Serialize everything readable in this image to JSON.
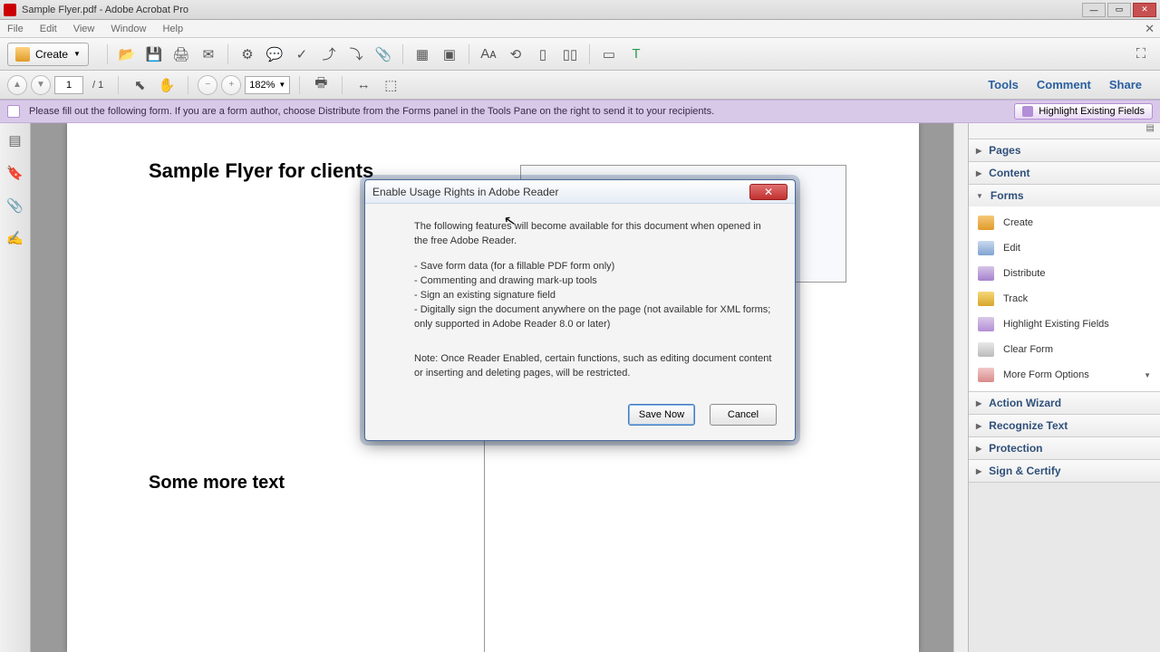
{
  "window": {
    "title": "Sample Flyer.pdf - Adobe Acrobat Pro"
  },
  "menus": {
    "file": "File",
    "edit": "Edit",
    "view": "View",
    "window": "Window",
    "help": "Help"
  },
  "toolbar": {
    "create": "Create"
  },
  "nav": {
    "page": "1",
    "total": "/ 1",
    "zoom": "182%"
  },
  "right_links": {
    "tools": "Tools",
    "comment": "Comment",
    "share": "Share"
  },
  "notice": {
    "text": "Please fill out the following form. If you are a form author, choose Distribute from the Forms panel in the Tools Pane on the right to send it to your recipients.",
    "highlight": "Highlight Existing Fields"
  },
  "doc": {
    "title": "Sample Flyer for clients",
    "subtitle": "Some more text"
  },
  "panels": {
    "pages": "Pages",
    "content": "Content",
    "forms": "Forms",
    "action": "Action Wizard",
    "recognize": "Recognize Text",
    "protection": "Protection",
    "sign": "Sign & Certify",
    "forms_items": {
      "create": "Create",
      "edit": "Edit",
      "distribute": "Distribute",
      "track": "Track",
      "highlight": "Highlight Existing Fields",
      "clear": "Clear Form",
      "more": "More Form Options"
    }
  },
  "dialog": {
    "title": "Enable Usage Rights in Adobe Reader",
    "intro": "The following features will become available for this document when opened in the free Adobe Reader.",
    "f1": "Save form data (for a fillable PDF form only)",
    "f2": "Commenting and drawing mark-up tools",
    "f3": "Sign an existing signature field",
    "f4": "Digitally sign the document anywhere on the page (not available for XML forms; only supported in Adobe Reader 8.0 or later)",
    "note": "Note: Once Reader Enabled, certain functions, such as editing document content or inserting and deleting pages, will be restricted.",
    "save": "Save Now",
    "cancel": "Cancel"
  }
}
